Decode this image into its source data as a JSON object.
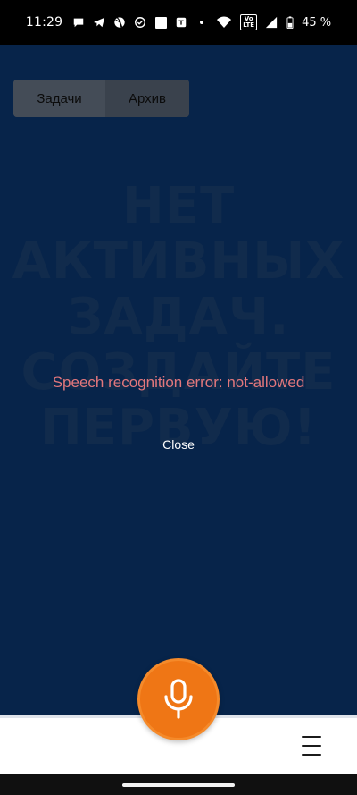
{
  "status_bar": {
    "time": "11:29",
    "volte_label": "Vo\nLTE",
    "battery_percent": "45 %"
  },
  "tabs": [
    {
      "label": "Задачи",
      "active": true
    },
    {
      "label": "Архив",
      "active": false
    }
  ],
  "empty_state": {
    "lines": [
      "НЕТ",
      "АКТИВНЫХ",
      "ЗАДАЧ.",
      "СОЗДАЙТЕ",
      "ПЕРВУЮ!"
    ]
  },
  "error": {
    "message": "Speech recognition error: not-allowed",
    "close_label": "Close"
  },
  "icons": {
    "fab": "microphone-icon",
    "menu": "hamburger-menu-icon"
  },
  "colors": {
    "background": "#07244a",
    "accent": "#ef7615",
    "error": "#e2777c"
  }
}
